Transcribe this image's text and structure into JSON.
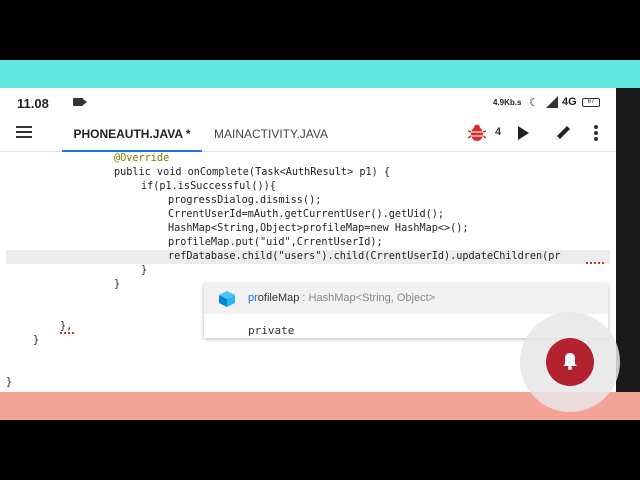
{
  "status_bar": {
    "time": "11.08",
    "network_speed": "4.9Kb.s",
    "network_type": "4G",
    "battery": "67"
  },
  "toolbar": {
    "tabs": [
      {
        "label": "PHONEAUTH.JAVA *",
        "active": true
      },
      {
        "label": "MAINACTIVITY.JAVA",
        "active": false
      }
    ],
    "bug_count": "4",
    "icons": [
      "menu-icon",
      "bug-icon",
      "play-icon",
      "edit-icon",
      "more-icon"
    ]
  },
  "code": {
    "lines": [
      "@Override",
      "public void onComplete(Task<AuthResult> p1) {",
      "if(p1.isSuccessful()){",
      "progressDialog.dismiss();",
      "CrrentUserId=mAuth.getCurrentUser().getUid();",
      "HashMap<String,Object>profileMap=new HashMap<>();",
      "profileMap.put(\"uid\",CrrentUserId);",
      "refDatabase.child(\"users\").child(CrrentUserId).updateChildren(pr",
      "}",
      "}",
      "},",
      "}",
      "}"
    ]
  },
  "autocomplete": {
    "match": "pr",
    "rest": "ofileMap",
    "type_hint": " : HashMap<String, Object>",
    "next_item": "private"
  },
  "colors": {
    "top_band": "#5ee8e0",
    "bottom_band": "#f4a497",
    "fab": "#b3222e",
    "tab_indicator": "#1a73e8"
  }
}
